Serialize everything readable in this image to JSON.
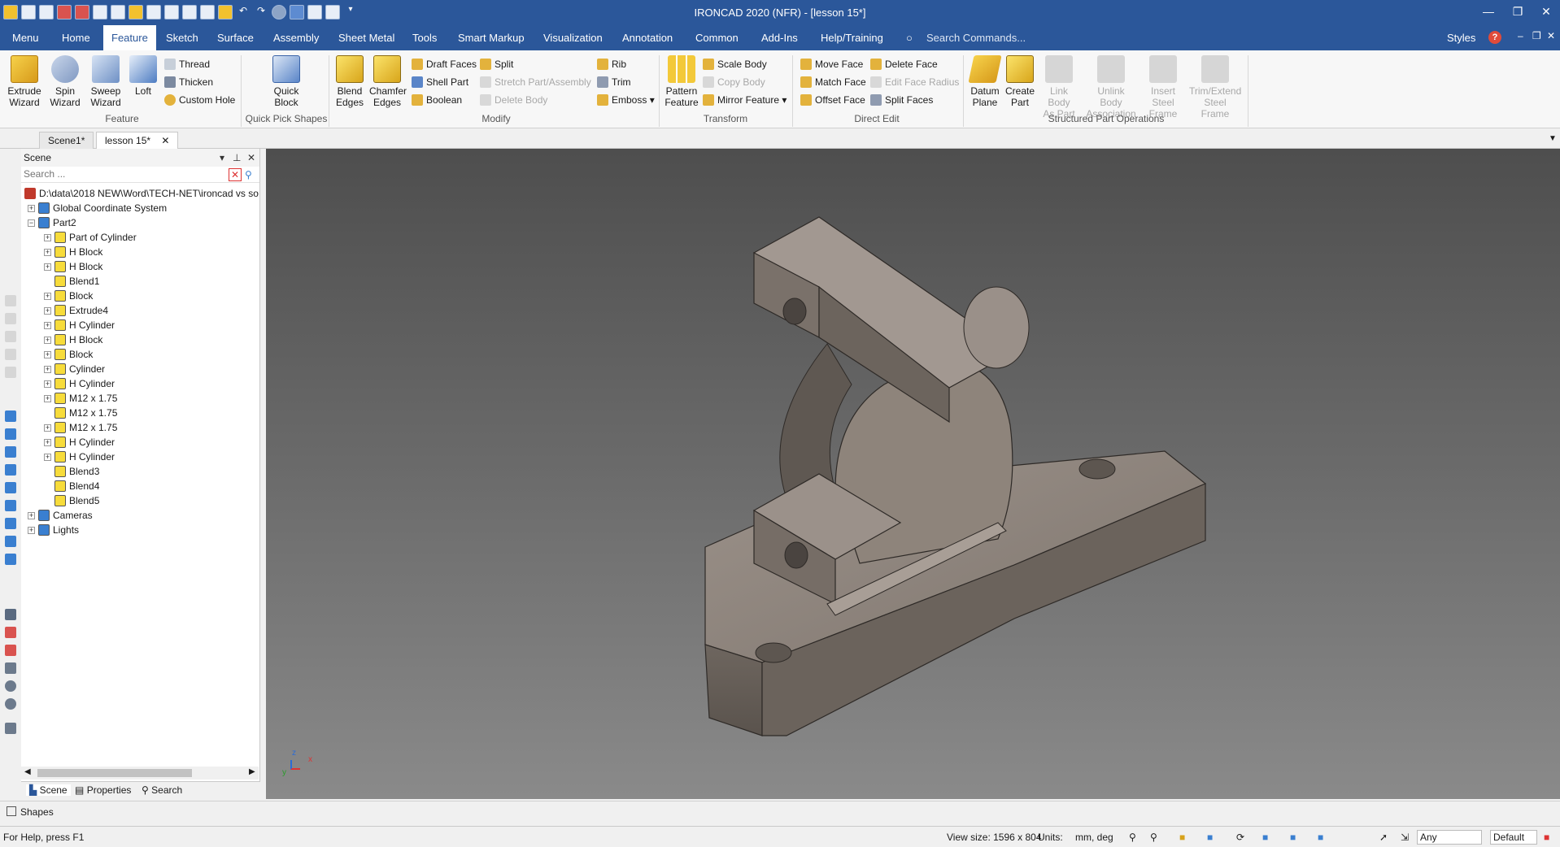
{
  "app": {
    "title": "IRONCAD 2020 (NFR) - [lesson 15*]"
  },
  "menubar": {
    "tabs": [
      "Menu",
      "Home",
      "Feature",
      "Sketch",
      "Surface",
      "Assembly",
      "Sheet Metal",
      "Tools",
      "Smart Markup",
      "Visualization",
      "Annotation",
      "Common",
      "Add-Ins",
      "Help/Training"
    ],
    "active_tab": "Feature",
    "search_placeholder": "Search Commands...",
    "styles_label": "Styles"
  },
  "ribbon": {
    "feature": {
      "label": "Feature",
      "extrude": "Extrude\nWizard",
      "spin": "Spin\nWizard",
      "sweep": "Sweep\nWizard",
      "loft": "Loft",
      "thread": "Thread",
      "thicken": "Thicken",
      "custom_hole": "Custom Hole"
    },
    "quick_pick": {
      "label": "Quick Pick Shapes",
      "quick_block": "Quick\nBlock"
    },
    "modify": {
      "label": "Modify",
      "blend": "Blend\nEdges",
      "chamfer": "Chamfer\nEdges",
      "draft": "Draft Faces",
      "shell": "Shell Part",
      "boolean": "Boolean",
      "split": "Split",
      "stretch": "Stretch Part/Assembly",
      "delete_body": "Delete Body",
      "rib": "Rib",
      "trim": "Trim",
      "emboss": "Emboss"
    },
    "transform": {
      "label": "Transform",
      "pattern": "Pattern\nFeature",
      "scale": "Scale Body",
      "copy": "Copy Body",
      "mirror": "Mirror Feature"
    },
    "direct_edit": {
      "label": "Direct Edit",
      "move": "Move Face",
      "match": "Match Face",
      "offset": "Offset Face",
      "delete_face": "Delete Face",
      "edit_radius": "Edit Face Radius",
      "split_faces": "Split Faces"
    },
    "structured": {
      "label": "Structured Part Operations",
      "datum": "Datum\nPlane",
      "create_part": "Create\nPart",
      "link_body": "Link Body\nAs Part",
      "unlink": "Unlink Body\nAssociation",
      "insert_steel": "Insert Steel\nFrame",
      "trim_steel": "Trim/Extend\nSteel Frame"
    }
  },
  "doc_tabs": [
    "Scene1*",
    "lesson 15*"
  ],
  "scene_panel": {
    "title": "Scene",
    "search_placeholder": "Search ...",
    "root": "D:\\data\\2018 NEW\\Word\\TECH-NET\\ironcad vs so",
    "items": [
      {
        "label": "Global Coordinate System",
        "level": 1,
        "exp": "+"
      },
      {
        "label": "Part2",
        "level": 1,
        "exp": "-"
      },
      {
        "label": "Part of Cylinder",
        "level": 2,
        "exp": "+"
      },
      {
        "label": "H Block",
        "level": 2,
        "exp": "+"
      },
      {
        "label": "H Block",
        "level": 2,
        "exp": "+"
      },
      {
        "label": "Blend1",
        "level": 2,
        "exp": ""
      },
      {
        "label": "Block",
        "level": 2,
        "exp": "+"
      },
      {
        "label": "Extrude4",
        "level": 2,
        "exp": "+"
      },
      {
        "label": "H Cylinder",
        "level": 2,
        "exp": "+"
      },
      {
        "label": "H Block",
        "level": 2,
        "exp": "+"
      },
      {
        "label": "Block",
        "level": 2,
        "exp": "+"
      },
      {
        "label": "Cylinder",
        "level": 2,
        "exp": "+"
      },
      {
        "label": "H Cylinder",
        "level": 2,
        "exp": "+"
      },
      {
        "label": "M12 x 1.75",
        "level": 2,
        "exp": "+"
      },
      {
        "label": "M12 x 1.75",
        "level": 2,
        "exp": ""
      },
      {
        "label": "M12 x 1.75",
        "level": 2,
        "exp": "+"
      },
      {
        "label": "H Cylinder",
        "level": 2,
        "exp": "+"
      },
      {
        "label": "H Cylinder",
        "level": 2,
        "exp": "+"
      },
      {
        "label": "Blend3",
        "level": 2,
        "exp": ""
      },
      {
        "label": "Blend4",
        "level": 2,
        "exp": ""
      },
      {
        "label": "Blend5",
        "level": 2,
        "exp": ""
      },
      {
        "label": "Cameras",
        "level": 1,
        "exp": "+"
      },
      {
        "label": "Lights",
        "level": 1,
        "exp": "+"
      }
    ],
    "tabs": {
      "scene": "Scene",
      "properties": "Properties",
      "search": "Search"
    }
  },
  "shapes_label": "Shapes",
  "status": {
    "help": "For Help, press F1",
    "view_size": "View size: 1596 x  804",
    "units_label": "Units:",
    "units_value": "mm, deg",
    "filter": "Any",
    "style": "Default"
  },
  "axis": {
    "x": "x",
    "y": "y",
    "z": "z"
  },
  "colors": {
    "brand": "#2b579a",
    "part": "#8a8078",
    "background_top": "#4e4e4e",
    "background_bottom": "#8a8a8a"
  }
}
